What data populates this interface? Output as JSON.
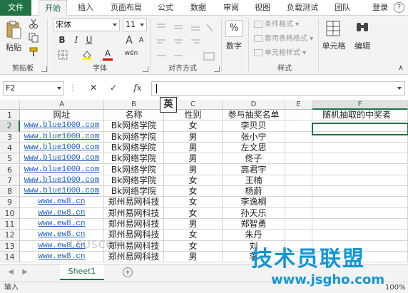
{
  "tabs": [
    "文件",
    "开始",
    "插入",
    "页面布局",
    "公式",
    "数据",
    "审阅",
    "视图",
    "负载测试",
    "团队"
  ],
  "login": "登录",
  "help": "?",
  "ribbon": {
    "paste": "粘贴",
    "clipboard": "剪贴板",
    "font_name": "宋体",
    "font_size": "11",
    "font_group": "字体",
    "bold": "B",
    "italic": "I",
    "underline": "U",
    "grow_font": "A",
    "shrink_font": "A",
    "font_color": "A",
    "wen_char": "wén",
    "alignment": "对齐方式",
    "number_pct": "%",
    "number": "数字",
    "cond_format": "条件格式",
    "table_format": "套用表格格式",
    "cell_style": "单元格样式",
    "styles": "样式",
    "cells": "单元格",
    "edit": "编辑"
  },
  "formula_bar": {
    "name_box": "F2",
    "fx": "fx",
    "cancel": "✕",
    "confirm": "✓",
    "ime": "英"
  },
  "columns": [
    "A",
    "B",
    "C",
    "D",
    "E",
    "F"
  ],
  "selected_col": "F",
  "rows": [
    {
      "n": "1",
      "a": "网址",
      "b": "名称",
      "c": "性别",
      "d": "参与抽奖名单",
      "e": "",
      "f": "随机抽取的中奖者"
    },
    {
      "n": "2",
      "a": "www.blue1000.com",
      "b": "Bk网络学院",
      "c": "女",
      "d": "李贝贝",
      "e": "",
      "f": ""
    },
    {
      "n": "3",
      "a": "www.blue1000.com",
      "b": "Bk网络学院",
      "c": "男",
      "d": "张小宁",
      "e": "",
      "f": ""
    },
    {
      "n": "4",
      "a": "www.blue1000.com",
      "b": "Bk网络学院",
      "c": "男",
      "d": "左文思",
      "e": "",
      "f": ""
    },
    {
      "n": "5",
      "a": "www.blue1000.com",
      "b": "Bk网络学院",
      "c": "男",
      "d": "佟子",
      "e": "",
      "f": ""
    },
    {
      "n": "6",
      "a": "www.blue1000.com",
      "b": "Bk网络学院",
      "c": "男",
      "d": "高君宇",
      "e": "",
      "f": ""
    },
    {
      "n": "7",
      "a": "www.blue1000.com",
      "b": "Bk网络学院",
      "c": "女",
      "d": "王楠",
      "e": "",
      "f": ""
    },
    {
      "n": "8",
      "a": "www.blue1000.com",
      "b": "Bk网络学院",
      "c": "女",
      "d": "杨蔚",
      "e": "",
      "f": ""
    },
    {
      "n": "9",
      "a": "www.ew8.cn",
      "b": "郑州易网科技",
      "c": "女",
      "d": "李逸桐",
      "e": "",
      "f": ""
    },
    {
      "n": "10",
      "a": "www.ew8.cn",
      "b": "郑州易网科技",
      "c": "女",
      "d": "孙天乐",
      "e": "",
      "f": ""
    },
    {
      "n": "11",
      "a": "www.ew8.cn",
      "b": "郑州易网科技",
      "c": "男",
      "d": "郑智勇",
      "e": "",
      "f": ""
    },
    {
      "n": "12",
      "a": "www.ew8.cn",
      "b": "郑州易网科技",
      "c": "女",
      "d": "朱丹",
      "e": "",
      "f": ""
    },
    {
      "n": "13",
      "a": "www.ew8.cn",
      "b": "郑州易网科技",
      "c": "女",
      "d": "刘",
      "e": "",
      "f": ""
    },
    {
      "n": "14",
      "a": "www.ew8.cn",
      "b": "郑州易网科技",
      "c": "男",
      "d": "李",
      "e": "",
      "f": ""
    }
  ],
  "sheet_tab": "Sheet1",
  "add_sheet": "+",
  "status": {
    "mode": "输入",
    "zoom": "100%"
  },
  "watermark": {
    "brand": "技术员联盟",
    "site": "www.jsgho.com",
    "faint": "LEUSCOM"
  }
}
